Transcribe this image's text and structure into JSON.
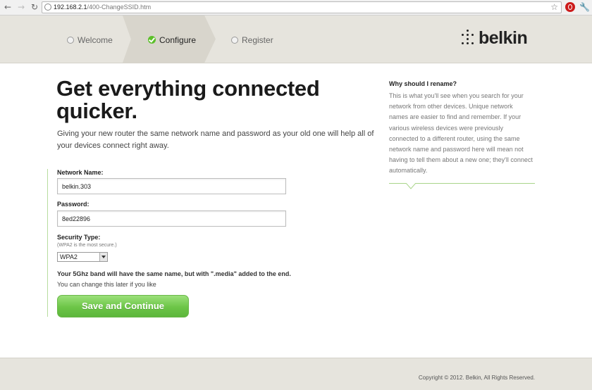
{
  "browser": {
    "url_host": "192.168.2.1",
    "url_path": "/400-ChangeSSID.htm"
  },
  "header": {
    "steps": [
      {
        "label": "Welcome",
        "state": "pending"
      },
      {
        "label": "Configure",
        "state": "active"
      },
      {
        "label": "Register",
        "state": "pending"
      }
    ],
    "logo_text": "belkin"
  },
  "main": {
    "headline": "Get everything connected quicker.",
    "subtitle": "Giving your new router the same network name and password as your old one will help all of your devices connect right away.",
    "network_name_label": "Network Name:",
    "network_name_value": "belkin.303",
    "password_label": "Password:",
    "password_value": "8ed22896",
    "security_type_label": "Security Type:",
    "security_hint": "(WPA2 is the most secure.)",
    "security_selected": "WPA2",
    "note_bold": "Your 5Ghz band will have the same name, but with \".media\" added to the end.",
    "note": "You can change this later if you like",
    "save_button": "Save and Continue"
  },
  "sidebar": {
    "title": "Why should I rename?",
    "text": "This is what you'll see when you search for your network from other devices. Unique network names are easier to find and remember. If your various wireless devices were previously connected to a different router, using the same network name and password here will mean not having to tell them about a new one; they'll connect automatically."
  },
  "footer": {
    "copyright": "Copyright © 2012. Belkin, All Rights Reserved."
  },
  "colors": {
    "accent_green": "#6cc547",
    "header_bg": "#e6e4dd"
  }
}
